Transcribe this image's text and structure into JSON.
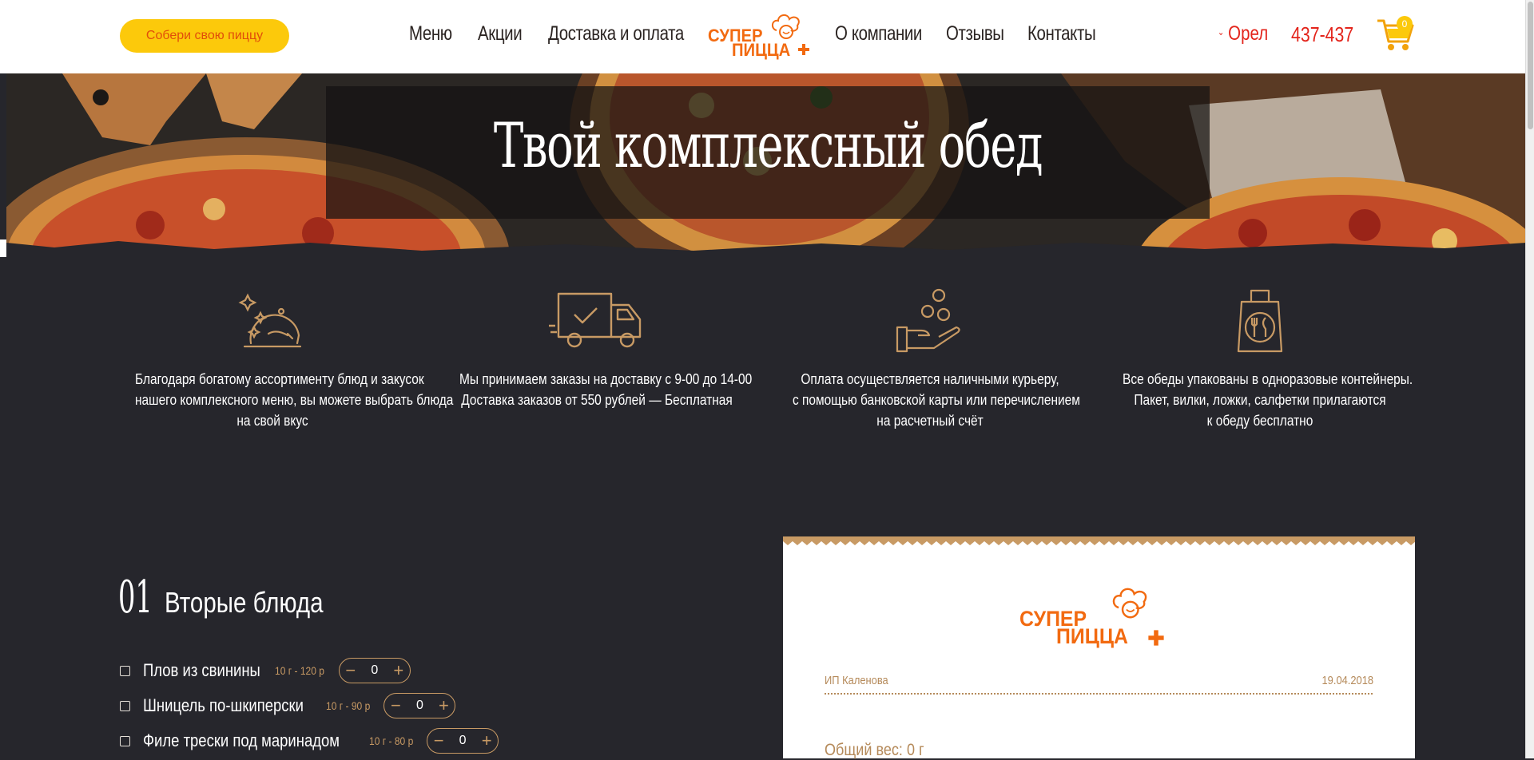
{
  "header": {
    "build_button": "Собери свою пиццу",
    "nav": [
      "Меню",
      "Акции",
      "Доставка и оплата",
      "О компании",
      "Отзывы",
      "Контакты"
    ],
    "logo_line1": "СУПЕР",
    "logo_line2": "ПИЦЦА",
    "city": "Орел",
    "phone": "437-437",
    "cart_count": "0"
  },
  "hero": {
    "title": "Твой комплексный обед"
  },
  "features": [
    {
      "icon": "cloche-icon",
      "lines": [
        "Благодаря богатому ассортименту блюд и закусок",
        "нашего комплексного меню,  вы можете выбрать блюда",
        "на свой вкус"
      ]
    },
    {
      "icon": "delivery-truck-icon",
      "lines": [
        "Мы принимаем заказы на доставку с 9-00 до 14-00",
        "Доставка заказов от  550 рублей — Бесплатная"
      ]
    },
    {
      "icon": "coins-hand-icon",
      "lines": [
        "Оплата осуществляется наличными курьеру,",
        "с помощью банковской карты или перечислением",
        "на расчетный счёт"
      ]
    },
    {
      "icon": "cutlery-bag-icon",
      "lines": [
        "Все обеды упакованы в одноразовые контейнеры.",
        "Пакет, вилки, ложки, салфетки прилагаются",
        "к обеду бесплатно"
      ]
    }
  ],
  "section": {
    "number": "01",
    "title": "Вторые блюда",
    "items": [
      {
        "name": "Плов из свинины",
        "meta": "10 г - 120 р",
        "qty": "0"
      },
      {
        "name": "Шницель по-шкиперски",
        "meta": "10 г - 90 р",
        "qty": "0"
      },
      {
        "name": "Филе трески под маринадом",
        "meta": "10 г - 80 р",
        "qty": "0"
      }
    ]
  },
  "receipt": {
    "logo_line1": "СУПЕР",
    "logo_line2": "ПИЦЦА",
    "company": "ИП Каленова",
    "date": "19.04.2018",
    "total_weight": "Общий вес: 0 г"
  },
  "colors": {
    "accent_yellow": "#fcc90b",
    "brand_orange": "#f26a10",
    "accent_red": "#e3241b",
    "dark_bg": "#26262c",
    "gold": "#c89a64"
  }
}
